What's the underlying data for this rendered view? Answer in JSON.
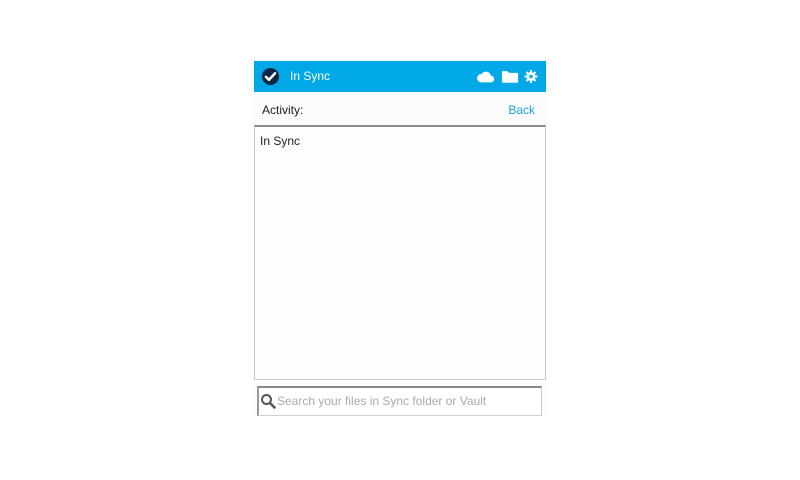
{
  "header": {
    "status_title": "In Sync",
    "status_icon": "check-circle-icon",
    "icons": [
      "cloud-icon",
      "folder-icon",
      "gear-icon"
    ],
    "background_color": "#00a8e8"
  },
  "activity": {
    "label": "Activity:",
    "back_label": "Back",
    "entries": [
      "In Sync"
    ]
  },
  "search": {
    "placeholder": "Search your files in Sync folder or Vault",
    "value": ""
  },
  "colors": {
    "accent": "#00a8e8",
    "link": "#1aa3d8"
  }
}
